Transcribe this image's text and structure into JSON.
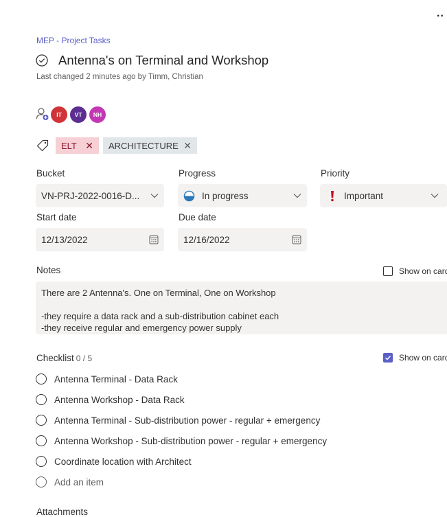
{
  "header": {
    "more_label": "..",
    "breadcrumb": "MEP - Project Tasks",
    "title": "Antenna's on Terminal and Workshop",
    "last_changed": "Last changed 2 minutes ago by Timm, Christian"
  },
  "assignees": [
    {
      "initials": "IT",
      "color": "#d13438"
    },
    {
      "initials": "VT",
      "color": "#5c2e91"
    },
    {
      "initials": "NH",
      "color": "#c239b3"
    }
  ],
  "labels": [
    {
      "text": "ELT",
      "remove": "✕",
      "color": "#f6d0d4"
    },
    {
      "text": "ARCHITECTURE",
      "remove": "✕",
      "color": "#e1e6e9"
    }
  ],
  "fields": {
    "bucket": {
      "label": "Bucket",
      "value": "VN-PRJ-2022-0016-D..."
    },
    "progress": {
      "label": "Progress",
      "value": "In progress"
    },
    "priority": {
      "label": "Priority",
      "value": "Important",
      "icon": "exclamation-icon"
    },
    "start_date": {
      "label": "Start date",
      "value": "12/13/2022"
    },
    "due_date": {
      "label": "Due date",
      "value": "12/16/2022"
    }
  },
  "notes": {
    "label": "Notes",
    "show_on_card": "Show on card",
    "show_on_card_checked": false,
    "text": "There are 2 Antenna's. One on Terminal, One on Workshop\n\n-they require a data rack and a sub-distribution cabinet each\n-they receive regular and emergency power supply"
  },
  "checklist": {
    "label": "Checklist",
    "count": "0 / 5",
    "show_on_card": "Show on card",
    "show_on_card_checked": true,
    "items": [
      "Antenna Terminal - Data Rack",
      "Antenna Workshop - Data Rack",
      "Antenna Terminal - Sub-distribution power - regular + emergency",
      "Antenna Workshop - Sub-distribution power - regular + emergency",
      "Coordinate location with Architect"
    ],
    "add_item": "Add an item"
  },
  "attachments": {
    "label": "Attachments"
  },
  "colors": {
    "accent": "#5b5fc7",
    "important": "#c50f1f"
  }
}
